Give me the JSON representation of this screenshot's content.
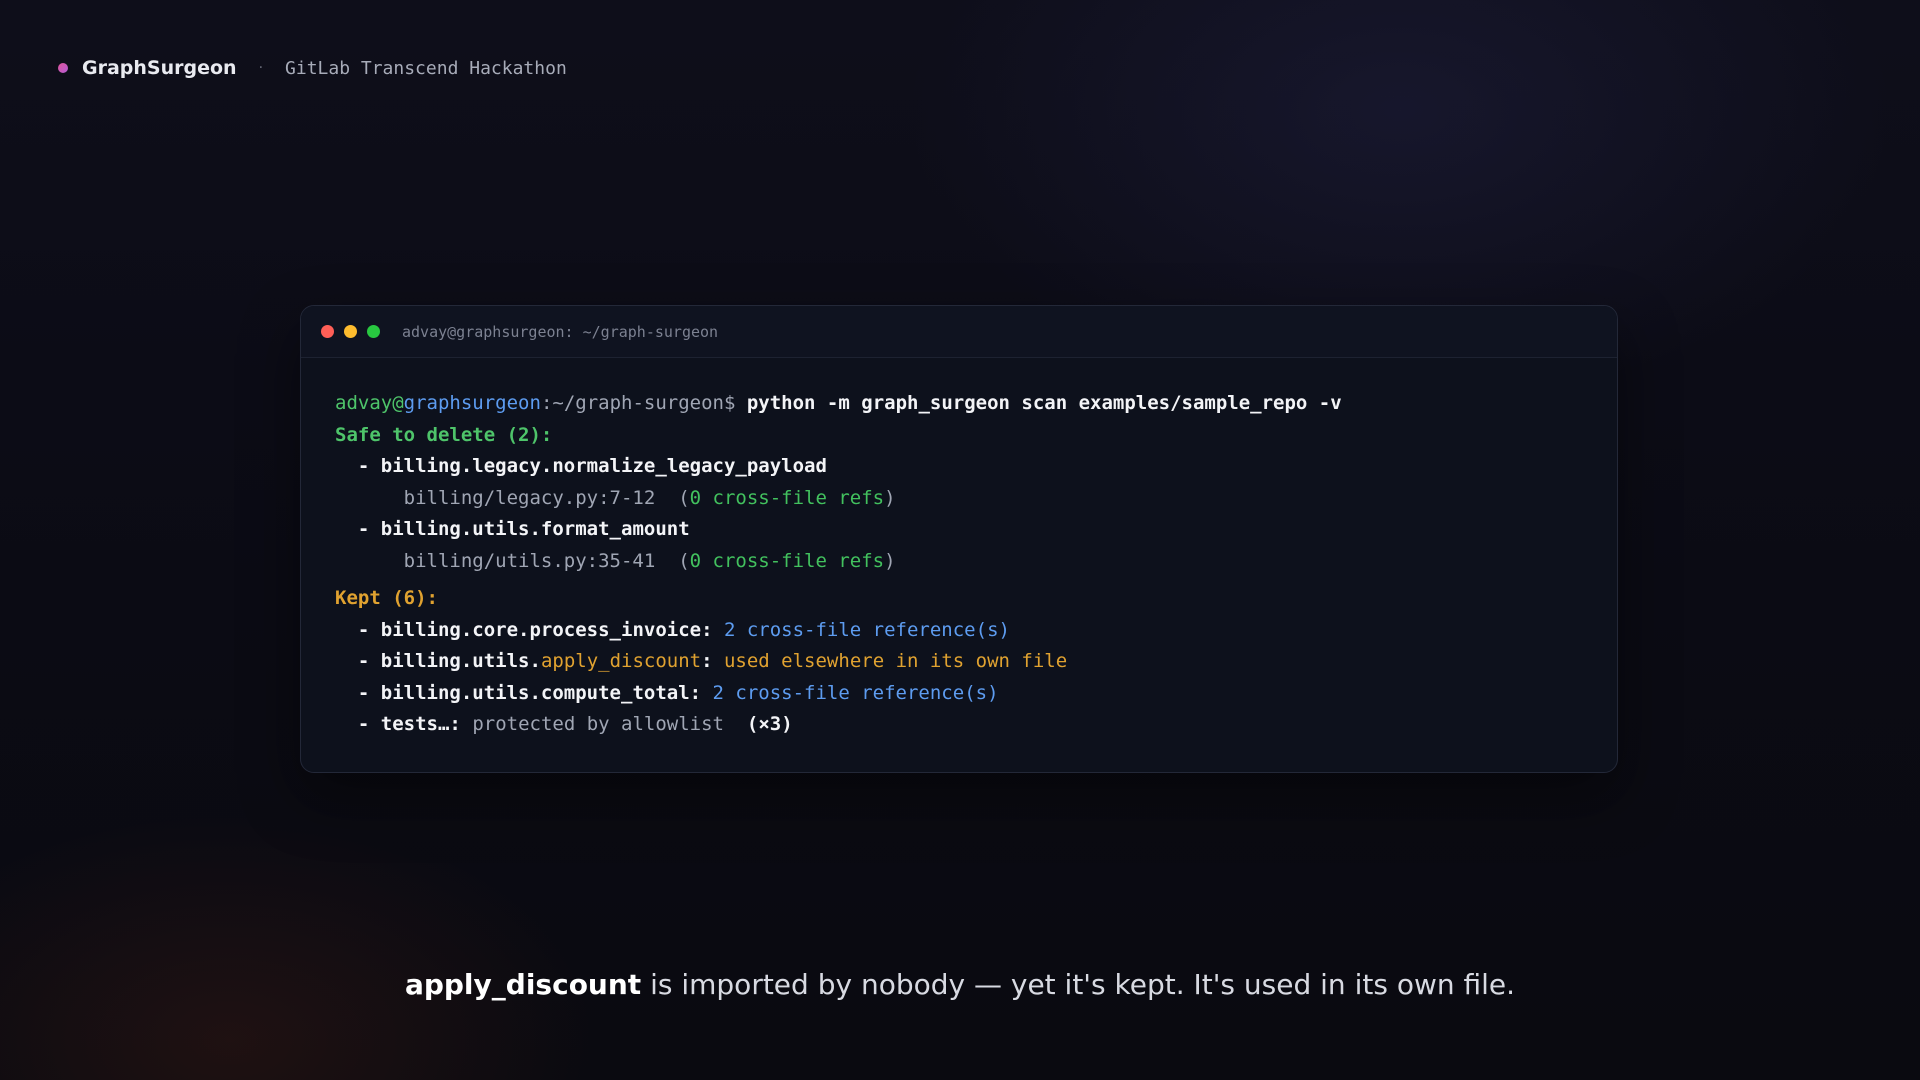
{
  "header": {
    "brand": "GraphSurgeon",
    "separator": "·",
    "event": "GitLab Transcend Hackathon"
  },
  "terminal": {
    "window_title": "advay@graphsurgeon: ~/graph-surgeon",
    "prompt": {
      "user": "advay",
      "at": "@",
      "host": "graphsurgeon",
      "path": ":~/graph-surgeon$",
      "command": "python -m graph_surgeon scan examples/sample_repo -v"
    },
    "safe_header": "Safe to delete (2):",
    "safe_items": [
      {
        "dash": "- ",
        "name": "billing.legacy.normalize_legacy_payload",
        "location": "billing/legacy.py:7-12",
        "open": "(",
        "refs": "0 cross-file refs",
        "close": ")"
      },
      {
        "dash": "- ",
        "name": "billing.utils.format_amount",
        "location": "billing/utils.py:35-41",
        "open": "(",
        "refs": "0 cross-file refs",
        "close": ")"
      }
    ],
    "kept_header": "Kept (6):",
    "kept_items": [
      {
        "dash": "- ",
        "name": "billing.core.process_invoice",
        "colon": ": ",
        "reason": "2 cross-file reference(s)"
      },
      {
        "dash": "- ",
        "name_prefix": "billing.utils.",
        "name_highlight": "apply_discount",
        "colon": ": ",
        "reason": "used elsewhere in its own file"
      },
      {
        "dash": "- ",
        "name": "billing.utils.compute_total",
        "colon": ": ",
        "reason": "2 cross-file reference(s)"
      },
      {
        "dash": "- ",
        "name": "tests…",
        "colon": ": ",
        "reason": "protected by allowlist",
        "count": "(×3)"
      }
    ]
  },
  "caption": {
    "emphasis": "apply_discount",
    "rest": " is imported by nobody — yet it's kept. It's used in its own file."
  },
  "colors": {
    "prompt_user": "#4ec46a",
    "prompt_host": "#5d9cf0",
    "safe": "#4ec46a",
    "kept": "#e0a230",
    "refs_blue": "#5d9cf0",
    "traffic_red": "#ff5f57",
    "traffic_yellow": "#febc2e",
    "traffic_green": "#28c840"
  }
}
